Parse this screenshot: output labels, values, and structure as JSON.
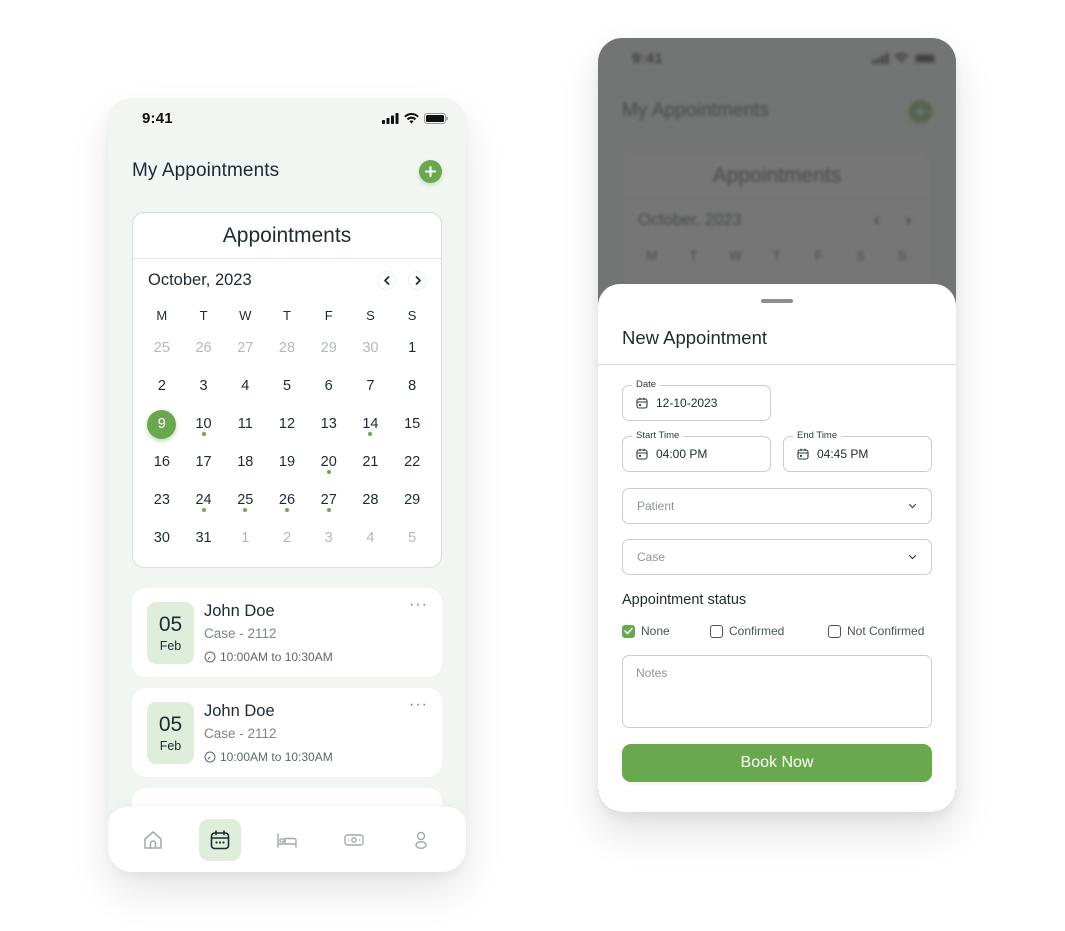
{
  "status_bar": {
    "time": "9:41"
  },
  "header": {
    "title": "My Appointments",
    "add_icon": "plus-circle-icon"
  },
  "calendar": {
    "title": "Appointments",
    "month_label": "October, 2023",
    "prev_icon": "chevron-left-icon",
    "next_icon": "chevron-right-icon",
    "weekdays": [
      "M",
      "T",
      "W",
      "T",
      "F",
      "S",
      "S"
    ],
    "selected_day": "9",
    "days": [
      {
        "label": "25",
        "muted": true
      },
      {
        "label": "26",
        "muted": true
      },
      {
        "label": "27",
        "muted": true
      },
      {
        "label": "28",
        "muted": true
      },
      {
        "label": "29",
        "muted": true
      },
      {
        "label": "30",
        "muted": true
      },
      {
        "label": "1"
      },
      {
        "label": "2"
      },
      {
        "label": "3"
      },
      {
        "label": "4"
      },
      {
        "label": "5"
      },
      {
        "label": "6"
      },
      {
        "label": "7"
      },
      {
        "label": "8"
      },
      {
        "label": "9",
        "selected": true
      },
      {
        "label": "10",
        "event": true
      },
      {
        "label": "11"
      },
      {
        "label": "12"
      },
      {
        "label": "13"
      },
      {
        "label": "14",
        "event": true
      },
      {
        "label": "15"
      },
      {
        "label": "16"
      },
      {
        "label": "17"
      },
      {
        "label": "18"
      },
      {
        "label": "19"
      },
      {
        "label": "20",
        "event": true
      },
      {
        "label": "21"
      },
      {
        "label": "22"
      },
      {
        "label": "23"
      },
      {
        "label": "24",
        "event": true
      },
      {
        "label": "25",
        "event": true
      },
      {
        "label": "26",
        "event": true
      },
      {
        "label": "27",
        "event": true
      },
      {
        "label": "28"
      },
      {
        "label": "29"
      },
      {
        "label": "30"
      },
      {
        "label": "31"
      },
      {
        "label": "1",
        "muted": true
      },
      {
        "label": "2",
        "muted": true
      },
      {
        "label": "3",
        "muted": true
      },
      {
        "label": "4",
        "muted": true
      },
      {
        "label": "5",
        "muted": true
      }
    ]
  },
  "appointments": [
    {
      "day": "05",
      "month": "Feb",
      "name": "John Doe",
      "case": "Case - 2112",
      "time": "10:00AM to 10:30AM",
      "more": "···"
    },
    {
      "day": "05",
      "month": "Feb",
      "name": "John Doe",
      "case": "Case - 2112",
      "time": "10:00AM to 10:30AM",
      "more": "···"
    }
  ],
  "bottom_nav": {
    "active": "calendar",
    "items": [
      {
        "id": "home",
        "icon": "home-icon"
      },
      {
        "id": "calendar",
        "icon": "calendar-icon"
      },
      {
        "id": "bed",
        "icon": "bed-icon"
      },
      {
        "id": "money",
        "icon": "money-icon"
      },
      {
        "id": "profile",
        "icon": "user-icon"
      }
    ]
  },
  "new_appointment": {
    "title": "New Appointment",
    "date": {
      "label": "Date",
      "value": "12-10-2023"
    },
    "start_time": {
      "label": "Start Time",
      "value": "04:00 PM"
    },
    "end_time": {
      "label": "End Time",
      "value": "04:45 PM"
    },
    "patient": {
      "placeholder": "Patient"
    },
    "case": {
      "placeholder": "Case"
    },
    "status_label": "Appointment status",
    "status_options": [
      {
        "label": "None",
        "checked": true
      },
      {
        "label": "Confirmed",
        "checked": false
      },
      {
        "label": "Not Confirmed",
        "checked": false
      }
    ],
    "notes": {
      "placeholder": "Notes"
    },
    "submit_label": "Book Now"
  },
  "colors": {
    "accent": "#6aa84f",
    "accent_light": "#dfeddb",
    "background": "#f1f6f3",
    "text": "#1c2b33"
  }
}
